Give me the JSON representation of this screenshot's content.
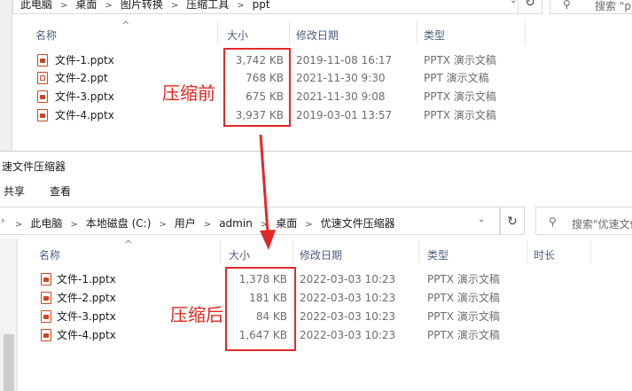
{
  "top_window": {
    "breadcrumb": [
      "此电脑",
      "桌面",
      "图片转换",
      "压缩工具",
      "ppt"
    ],
    "search_placeholder": "搜索 \"ppt\"",
    "columns": {
      "name": "名称",
      "size": "大小",
      "date": "修改日期",
      "type": "类型"
    },
    "files": [
      {
        "name": "文件-1.pptx",
        "size": "3,742 KB",
        "date": "2019-11-08 16:17",
        "type": "PPTX 演示文稿",
        "icon": "pptx-file-icon"
      },
      {
        "name": "文件-2.ppt",
        "size": "768 KB",
        "date": "2021-11-30 9:30",
        "type": "PPT 演示文稿",
        "icon": "ppt-file-icon"
      },
      {
        "name": "文件-3.pptx",
        "size": "675 KB",
        "date": "2021-11-30 9:08",
        "type": "PPTX 演示文稿",
        "icon": "pptx-file-icon"
      },
      {
        "name": "文件-4.pptx",
        "size": "3,937 KB",
        "date": "2019-03-01 13:57",
        "type": "PPTX 演示文稿",
        "icon": "pptx-file-icon"
      }
    ],
    "annotation": "压缩前"
  },
  "bottom_window": {
    "title": "速文件压缩器",
    "ribbon_tabs": [
      "共享",
      "查看"
    ],
    "breadcrumb": [
      "此电脑",
      "本地磁盘 (C:)",
      "用户",
      "admin",
      "桌面",
      "优速文件压缩器"
    ],
    "search_placeholder": "搜索\"优速文件",
    "columns": {
      "name": "名称",
      "size": "大小",
      "date": "修改日期",
      "type": "类型",
      "duration": "时长"
    },
    "files": [
      {
        "name": "文件-1.pptx",
        "size": "1,378 KB",
        "date": "2022-03-03 10:23",
        "type": "PPTX 演示文稿",
        "icon": "pptx-file-icon"
      },
      {
        "name": "文件-2.pptx",
        "size": "181 KB",
        "date": "2022-03-03 10:23",
        "type": "PPTX 演示文稿",
        "icon": "pptx-file-icon"
      },
      {
        "name": "文件-3.pptx",
        "size": "84 KB",
        "date": "2022-03-03 10:23",
        "type": "PPTX 演示文稿",
        "icon": "pptx-file-icon"
      },
      {
        "name": "文件-4.pptx",
        "size": "1,647 KB",
        "date": "2022-03-03 10:23",
        "type": "PPTX 演示文稿",
        "icon": "pptx-file-icon"
      }
    ],
    "annotation": "压缩后"
  },
  "colors": {
    "highlight": "#e02a2a",
    "header_text": "#4d6082",
    "pptx_icon": "#d04423"
  }
}
